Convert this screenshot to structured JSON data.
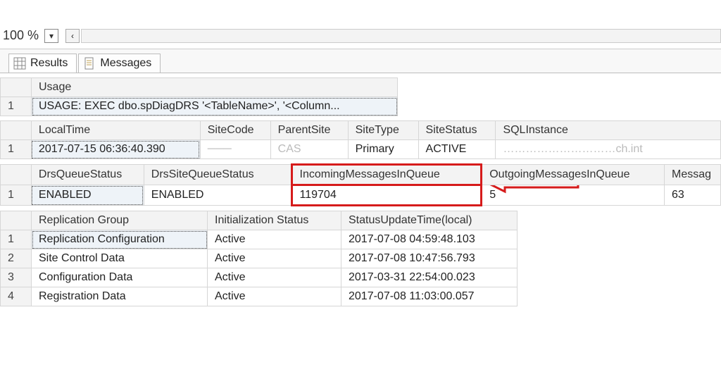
{
  "zoom": {
    "label": "100 %"
  },
  "tabs": {
    "results": "Results",
    "messages": "Messages",
    "active": "results"
  },
  "grid1": {
    "headers": [
      "Usage"
    ],
    "rows": [
      {
        "n": "1",
        "usage": "USAGE: EXEC dbo.spDiagDRS '<TableName>', '<Column..."
      }
    ]
  },
  "grid2": {
    "headers": [
      "LocalTime",
      "SiteCode",
      "ParentSite",
      "SiteType",
      "SiteStatus",
      "SQLInstance"
    ],
    "rows": [
      {
        "n": "1",
        "LocalTime": "2017-07-15 06:36:40.390",
        "SiteCode": "───",
        "ParentSite": "CAS",
        "SiteType": "Primary",
        "SiteStatus": "ACTIVE",
        "SQLInstance": "…………………………ch.int"
      }
    ]
  },
  "grid3": {
    "headers": [
      "DrsQueueStatus",
      "DrsSiteQueueStatus",
      "IncomingMessagesInQueue",
      "OutgoingMessagesInQueue",
      "Messag"
    ],
    "rows": [
      {
        "n": "1",
        "DrsQueueStatus": "ENABLED",
        "DrsSiteQueueStatus": "ENABLED",
        "IncomingMessagesInQueue": "119704",
        "OutgoingMessagesInQueue": "5",
        "Messag": "63"
      }
    ]
  },
  "grid4": {
    "headers": [
      "Replication Group",
      "Initialization Status",
      "StatusUpdateTime(local)"
    ],
    "rows": [
      {
        "n": "1",
        "rg": "Replication Configuration",
        "init": "Active",
        "ts": "2017-07-08 04:59:48.103"
      },
      {
        "n": "2",
        "rg": "Site Control Data",
        "init": "Active",
        "ts": "2017-07-08 10:47:56.793"
      },
      {
        "n": "3",
        "rg": "Configuration Data",
        "init": "Active",
        "ts": "2017-03-31 22:54:00.023"
      },
      {
        "n": "4",
        "rg": "Registration Data",
        "init": "Active",
        "ts": "2017-07-08 11:03:00.057"
      }
    ]
  }
}
